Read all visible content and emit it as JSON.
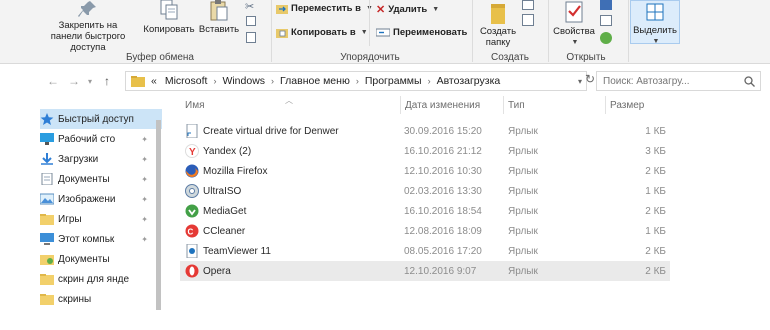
{
  "ribbon": {
    "clipboard": {
      "pin_label": "Закрепить на панели быстрого доступа",
      "copy_label": "Копировать",
      "paste_label": "Вставить",
      "group_label": "Буфер обмена"
    },
    "organize": {
      "move_label": "Переместить в",
      "copy_to_label": "Копировать в",
      "delete_label": "Удалить",
      "rename_label": "Переименовать",
      "group_label": "Упорядочить"
    },
    "create": {
      "new_folder_label": "Создать папку",
      "group_label": "Создать"
    },
    "open": {
      "properties_label": "Свойства",
      "group_label": "Открыть"
    },
    "select": {
      "select_label": "Выделить"
    }
  },
  "address": {
    "prefix": "«",
    "crumbs": [
      "Microsoft",
      "Windows",
      "Главное меню",
      "Программы",
      "Автозагрузка"
    ]
  },
  "search": {
    "placeholder": "Поиск: Автозагру..."
  },
  "sidebar": {
    "items": [
      {
        "label": "Быстрый доступ",
        "icon": "star-icon",
        "pinned": false
      },
      {
        "label": "Рабочий сто",
        "icon": "desktop-icon",
        "pinned": true
      },
      {
        "label": "Загрузки",
        "icon": "download-icon",
        "pinned": true
      },
      {
        "label": "Документы",
        "icon": "documents-icon",
        "pinned": true
      },
      {
        "label": "Изображени",
        "icon": "pictures-icon",
        "pinned": true
      },
      {
        "label": "Игры",
        "icon": "folder-icon",
        "pinned": true
      },
      {
        "label": "Этот компьк",
        "icon": "computer-icon",
        "pinned": true
      },
      {
        "label": "Документы",
        "icon": "documents-green-icon",
        "pinned": false
      },
      {
        "label": "скрин для янде",
        "icon": "folder-icon",
        "pinned": false
      },
      {
        "label": "скрины",
        "icon": "folder-icon",
        "pinned": false
      }
    ]
  },
  "columns": {
    "name": "Имя",
    "date": "Дата изменения",
    "type": "Тип",
    "size": "Размер"
  },
  "files": [
    {
      "name": "Create virtual drive for Denwer",
      "date": "30.09.2016 15:20",
      "type": "Ярлык",
      "size": "1 КБ",
      "icon": "shortcut-icon"
    },
    {
      "name": "Yandex (2)",
      "date": "16.10.2016 21:12",
      "type": "Ярлык",
      "size": "3 КБ",
      "icon": "yandex-icon"
    },
    {
      "name": "Mozilla Firefox",
      "date": "12.10.2016 10:30",
      "type": "Ярлык",
      "size": "2 КБ",
      "icon": "firefox-icon"
    },
    {
      "name": "UltraISO",
      "date": "02.03.2016 13:30",
      "type": "Ярлык",
      "size": "1 КБ",
      "icon": "ultraiso-icon"
    },
    {
      "name": "MediaGet",
      "date": "16.10.2016 18:54",
      "type": "Ярлык",
      "size": "2 КБ",
      "icon": "mediaget-icon"
    },
    {
      "name": "CCleaner",
      "date": "12.08.2016 18:09",
      "type": "Ярлык",
      "size": "1 КБ",
      "icon": "ccleaner-icon"
    },
    {
      "name": "TeamViewer 11",
      "date": "08.05.2016 17:20",
      "type": "Ярлык",
      "size": "2 КБ",
      "icon": "teamviewer-icon"
    },
    {
      "name": "Opera",
      "date": "12.10.2016 9:07",
      "type": "Ярлык",
      "size": "2 КБ",
      "icon": "opera-icon"
    }
  ],
  "colors": {
    "selection": "#cce4f7",
    "row_highlight": "#eaeaea",
    "accent": "#1e73be"
  }
}
